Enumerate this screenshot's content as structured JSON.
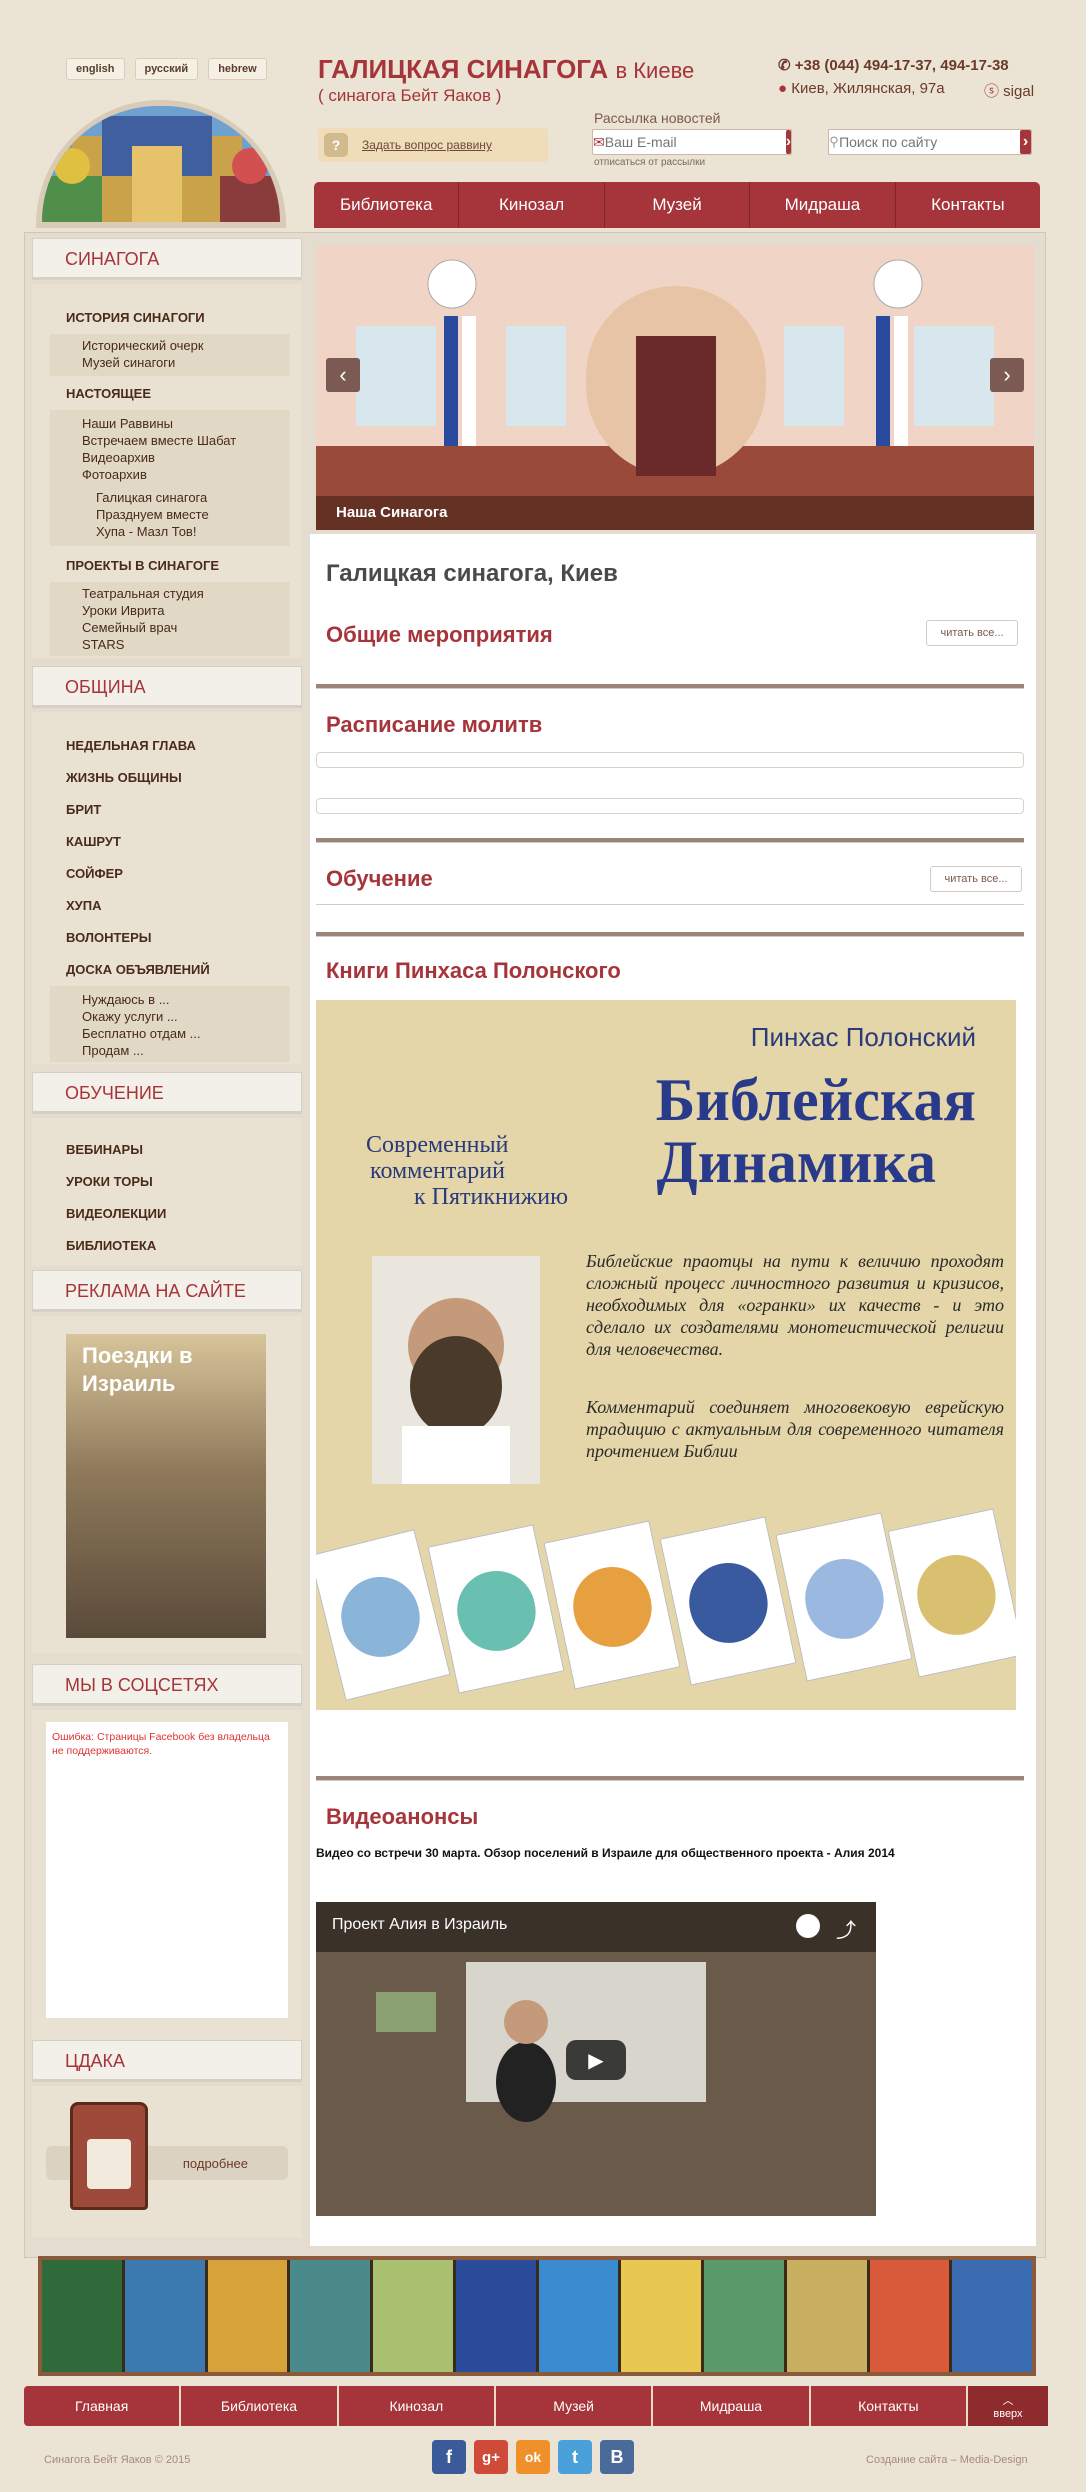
{
  "header": {
    "langs": [
      "english",
      "русский",
      "hebrew"
    ],
    "title": "ГАЛИЦКАЯ СИНАГОГА",
    "title_suffix": "в Киеве",
    "subtitle": "( синагога Бейт Яаков )",
    "phone": "+38 (044) 494-17-37, 494-17-38",
    "address": "Киев, Жилянская, 97а",
    "skype": "sigal",
    "ask_label": "Задать вопрос раввину",
    "newsletter_label": "Рассылка новостей",
    "email_placeholder": "Ваш E-mail",
    "unsubscribe": "отписаться от рассылки",
    "search_placeholder": "Поиск по сайту"
  },
  "topnav": [
    "Библиотека",
    "Кинозал",
    "Музей",
    "Мидраша",
    "Контакты"
  ],
  "sidebar": {
    "synagogue": {
      "title": "СИНАГОГА",
      "history": "ИСТОРИЯ СИНАГОГИ",
      "history_items": [
        "Исторический очерк",
        "Музей синагоги"
      ],
      "present": "НАСТОЯЩЕЕ",
      "present_items": [
        "Наши Раввины",
        "Встречаем вместе Шабат",
        "Видеоархив",
        "Фотоархив"
      ],
      "photo_items": [
        "Галицкая синагога",
        "Празднуем вместе",
        "Хупа - Мазл Тов!"
      ],
      "projects": "ПРОЕКТЫ В СИНАГОГЕ",
      "project_items": [
        "Театральная студия",
        "Уроки Иврита",
        "Семейный врач",
        "STARS"
      ]
    },
    "community": {
      "title": "ОБЩИНА",
      "items": [
        "НЕДЕЛЬНАЯ ГЛАВА",
        "ЖИЗНЬ ОБЩИНЫ",
        "БРИТ",
        "КАШРУТ",
        "СОЙФЕР",
        "ХУПА",
        "ВОЛОНТЕРЫ",
        "ДОСКА ОБЪЯВЛЕНИЙ"
      ],
      "board_items": [
        "Нуждаюсь в ...",
        "Окажу услуги ...",
        "Бесплатно отдам ...",
        "Продам ..."
      ]
    },
    "education": {
      "title": "ОБУЧЕНИЕ",
      "items": [
        "ВЕБИНАРЫ",
        "УРОКИ ТОРЫ",
        "ВИДЕОЛЕКЦИИ",
        "БИБЛИОТЕКА"
      ]
    },
    "ads": {
      "title": "РЕКЛАМА НА САЙТЕ",
      "banner": "Поездки в Израиль"
    },
    "social": {
      "title": "МЫ В СОЦСЕТЯХ",
      "error": "Ошибка: Страницы Facebook без владельца не поддерживаются."
    },
    "tzedaka": {
      "title": "ЦДАКА",
      "more": "подробнее"
    }
  },
  "slider": {
    "caption": "Наша Синагога"
  },
  "content": {
    "page_title": "Галицкая синагога, Киев",
    "events_title": "Общие мероприятия",
    "read_all": "читать все...",
    "prayers_title": "Расписание молитв",
    "study_title": "Обучение",
    "books_title": "Книги Пинхаса Полонского",
    "book": {
      "author": "Пинхас Полонский",
      "title1": "Библейская",
      "title2": "Динамика",
      "sub1": "Современный",
      "sub2": "комментарий",
      "sub3": "к Пятикнижию",
      "text1": "Библейские праотцы на пути к величию проходят сложный процесс личностного развития и кризисов, необходимых для «огранки» их качеств - и это сделало их создателями монотеистической религии для человечества.",
      "text2": "Комментарий соединяет многовековую еврейскую традицию с актуальным для современного читателя прочтением Библии"
    },
    "video_title": "Видеоанонсы",
    "video_desc": "Видео со встречи 30 марта. Обзор поселений в Израиле для общественного проекта - Алия 2014",
    "video_caption": "Проект Алия в Израиль"
  },
  "footer": {
    "nav": [
      "Главная",
      "Библиотека",
      "Кинозал",
      "Музей",
      "Мидраша",
      "Контакты"
    ],
    "up": "вверх",
    "copyright": "Синагога Бейт Яаков © 2015",
    "credit": "Создание сайта – Media-Design",
    "social": [
      "f",
      "g+",
      "ok",
      "t",
      "B"
    ]
  },
  "colors": {
    "brand": "#a5353a",
    "background": "#ebe3d4"
  }
}
